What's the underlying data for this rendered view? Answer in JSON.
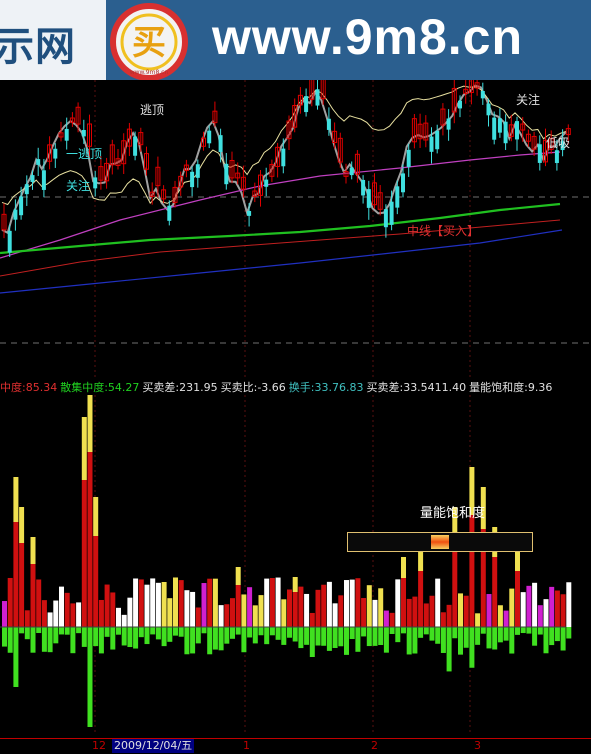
{
  "banner": {
    "left_text": "示网",
    "url_text": "www.9m8.cn",
    "logo_char": "买",
    "logo_small": "www.9m8.cn"
  },
  "colors": {
    "background": "#000000",
    "up": "#e00000",
    "down": "#40e0e0",
    "ma_short": "#e8e0a0",
    "ma_magenta": "#c040c0",
    "ma_green": "#20c020",
    "ma_red": "#c02020",
    "ma_blue": "#2030c0",
    "volume_red": "#d01010",
    "volume_yellow": "#f0e050",
    "volume_green": "#40e020",
    "volume_white": "#ffffff",
    "volume_magenta": "#d020d0"
  },
  "main_chart": {
    "annotations": [
      {
        "text": "逃顶",
        "color": "#e0e0e0"
      },
      {
        "text": "一逃顶",
        "color": "#40e0e0"
      },
      {
        "text": "关注",
        "color": "#40e0e0"
      },
      {
        "text": "关注",
        "color": "#e0e0e0"
      },
      {
        "text": "低吸",
        "color": "#e0e0e0"
      },
      {
        "text": "中线【买入】",
        "color": "#e03030"
      }
    ]
  },
  "indicator_bar": [
    {
      "label": "中度:",
      "value": "85.34",
      "color": "#e03030"
    },
    {
      "label": "散集中度:",
      "value": "54.27",
      "color": "#20d020"
    },
    {
      "label": "买卖差:",
      "value": "231.95",
      "color": "#e0e0e0"
    },
    {
      "label": "买卖比:",
      "value": "-3.66",
      "color": "#e0e0e0"
    },
    {
      "label": "换手:",
      "value": "33.76.83",
      "color": "#40c0c0"
    },
    {
      "label": "买卖差:",
      "value": "33.5411.40",
      "color": "#e0e0e0"
    },
    {
      "label": "量能饱和度:",
      "value": "9.36",
      "color": "#e0e0e0"
    }
  ],
  "gauge": {
    "title": "量能饱和度",
    "level_percent": 47
  },
  "time_axis": {
    "labels": [
      "12",
      "2009/12/04/五",
      "1",
      "2",
      "3"
    ]
  }
}
